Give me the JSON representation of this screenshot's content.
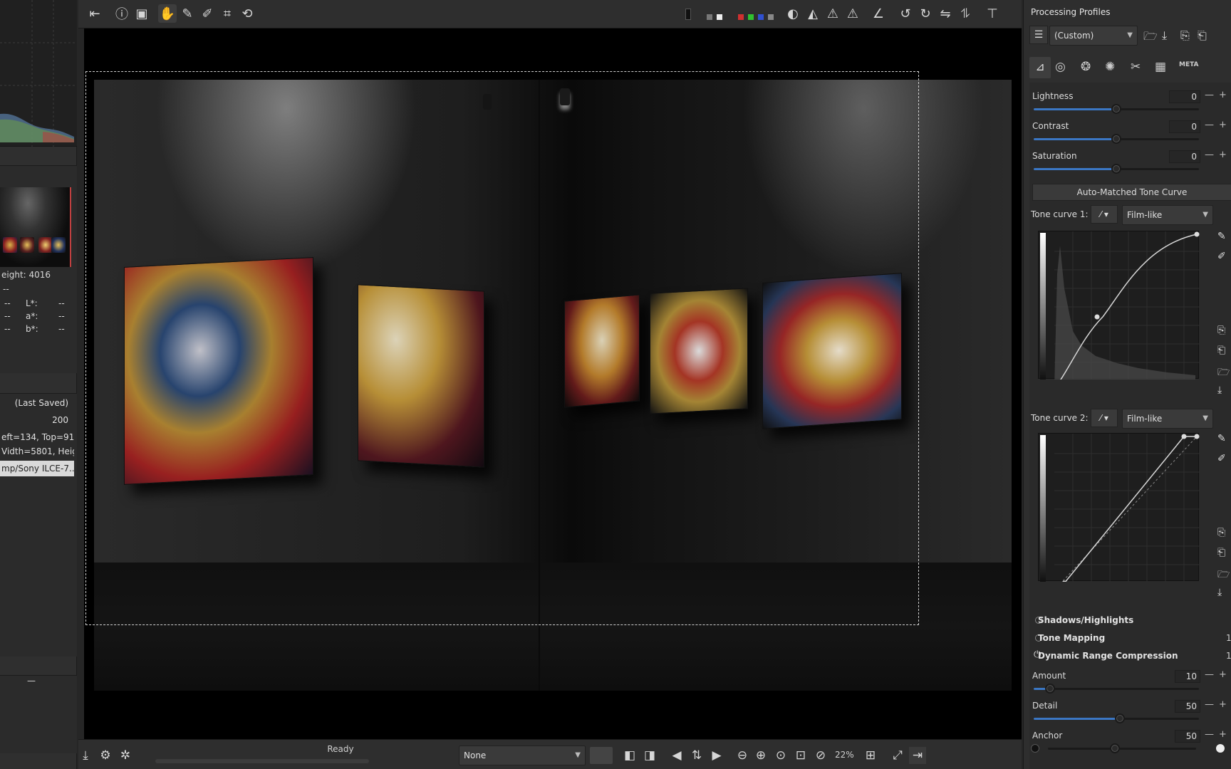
{
  "left_panel": {
    "exif_height": "eight: 4016",
    "exif_dash": "--",
    "lab": [
      {
        "label": "L*:",
        "value": "--",
        "left": "--"
      },
      {
        "label": "a*:",
        "value": "--",
        "left": "--"
      },
      {
        "label": "b*:",
        "value": "--",
        "left": "--"
      }
    ],
    "profile_last_saved": "(Last Saved)",
    "iso_value": "200",
    "crop_info_1": "eft=134, Top=91",
    "crop_info_2": "Vidth=5801, Heig...",
    "file_path": "mp/Sony ILCE-7...",
    "collapse_symbol": "—"
  },
  "toolbar": {
    "icons": [
      "collapse-left-panel-icon",
      "info-icon",
      "before-after-icon",
      "hand-tool-icon",
      "color-picker-icon",
      "white-balance-picker-icon",
      "crop-tool-icon",
      "straighten-tool-icon"
    ]
  },
  "status": {
    "text": "Ready",
    "progress": 0
  },
  "bottom_toolbar": {
    "preview_profile": "None",
    "zoom_level": "22%"
  },
  "right_panel": {
    "title": "Processing Profiles",
    "profile_dropdown": "(Custom)",
    "tab_meta_label": "META",
    "sliders_top": [
      {
        "label": "Lightness",
        "value": "0",
        "fraction": 0.5
      },
      {
        "label": "Contrast",
        "value": "0",
        "fraction": 0.5
      },
      {
        "label": "Saturation",
        "value": "0",
        "fraction": 0.5
      }
    ],
    "auto_matched_button": "Auto-Matched Tone Curve",
    "tone_curve_1_label": "Tone curve 1:",
    "tone_curve_1_mode": "Film-like",
    "tone_curve_2_label": "Tone curve 2:",
    "tone_curve_2_mode": "Film-like",
    "sections": [
      {
        "label": "Shadows/Highlights",
        "suffix": ""
      },
      {
        "label": "Tone Mapping",
        "suffix": "1"
      },
      {
        "label": "Dynamic Range Compression",
        "suffix": "1"
      }
    ],
    "sliders_drc": [
      {
        "label": "Amount",
        "value": "10",
        "fraction": 0.1
      },
      {
        "label": "Detail",
        "value": "50",
        "fraction": 0.5
      },
      {
        "label": "Anchor",
        "value": "50",
        "fraction": 0.5
      }
    ]
  },
  "colors": {
    "accent": "#3b77c4",
    "crop_border": "#cfcfcf"
  }
}
